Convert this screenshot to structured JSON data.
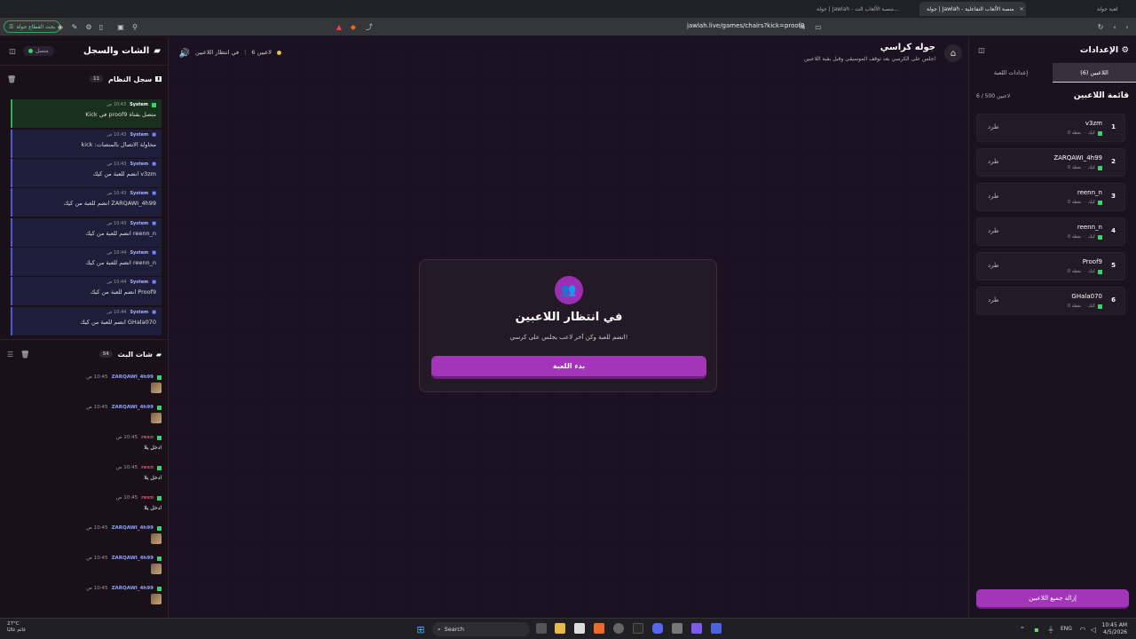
{
  "browser": {
    "tabs": [
      {
        "label": "لعبة جولة"
      },
      {
        "label": "جولة | Jawlah - منصة الألعاب الت..."
      },
      {
        "label": "جولة | Jawlah - منصة الألعاب التفاعلية"
      }
    ],
    "url": "jawlah.live/games/chairs?kick=proof9",
    "split_label": "بحث القطاع جولة"
  },
  "left_panel": {
    "title": "الشات والسجل",
    "connection": "متصل",
    "system_log": {
      "title": "سجل النظام",
      "count": "11",
      "items": [
        {
          "who": "System",
          "time": "10:43 ص",
          "text": "متصل بقناة proof9 في Kick"
        },
        {
          "who": "System",
          "time": "10:43 ص",
          "text": "محاولة الاتصال بالمنصات: kick"
        },
        {
          "who": "System",
          "time": "10:43 ص",
          "text": "v3zm انضم للعبة من كيك"
        },
        {
          "who": "System",
          "time": "10:43 ص",
          "text": "ZARQAWI_4h99 انضم للعبة من كيك"
        },
        {
          "who": "System",
          "time": "10:43 ص",
          "text": "reenn_n انضم للعبة من كيك"
        },
        {
          "who": "System",
          "time": "10:44 ص",
          "text": "reenn_n انضم للعبة من كيك"
        },
        {
          "who": "System",
          "time": "10:44 ص",
          "text": "Proof9 انضم للعبة من كيك"
        },
        {
          "who": "System",
          "time": "10:44 ص",
          "text": "GHala070 انضم للعبة من كيك"
        }
      ]
    },
    "stream_chat": {
      "title": "شات البث",
      "count": "54",
      "messages": [
        {
          "who": "ZARQAWI_4h99",
          "time": "10:45 ص",
          "text": ""
        },
        {
          "who": "ZARQAWI_4h99",
          "time": "10:45 ص",
          "text": ""
        },
        {
          "who": "rexn",
          "time": "10:45 ص",
          "text": "ادخل يلا"
        },
        {
          "who": "rexn",
          "time": "10:45 ص",
          "text": "ادخل يلا"
        },
        {
          "who": "rexn",
          "time": "10:45 ص",
          "text": "ادخل يلا"
        },
        {
          "who": "ZARQAWI_4h99",
          "time": "10:45 ص",
          "text": ""
        },
        {
          "who": "ZARQAWI_4h99",
          "time": "10:45 ص",
          "text": ""
        },
        {
          "who": "ZARQAWI_4h99",
          "time": "10:45 ص",
          "text": ""
        }
      ]
    }
  },
  "center": {
    "game_title": "جوله كراسي",
    "game_subtitle": "اجلس على الكرسي بعد توقف الموسيقى وقبل بقية اللاعبين",
    "player_count": "6 لاعبين",
    "waiting_status": "في انتظار اللاعبين",
    "card_title": "في انتظار اللاعبين",
    "card_subtitle": "انضم للعبة وكن آخر لاعب يجلس على كرسي!",
    "start_button": "بدء اللعبة"
  },
  "right_panel": {
    "title": "الإعدادات",
    "tab_players": "اللاعبين (6)",
    "tab_settings": "إعدادات اللعبة",
    "list_title": "قائمة اللاعبين",
    "list_count": "6 / 500 لاعبين",
    "players": [
      {
        "num": "1",
        "name": "v3zm",
        "platform": "كيك",
        "points": "0 نقطة",
        "kick": "طرد"
      },
      {
        "num": "2",
        "name": "ZARQAWI_4h99",
        "platform": "كيك",
        "points": "0 نقطة",
        "kick": "طرد"
      },
      {
        "num": "3",
        "name": "reenn_n",
        "platform": "كيك",
        "points": "0 نقطة",
        "kick": "طرد"
      },
      {
        "num": "4",
        "name": "reenn_n",
        "platform": "كيك",
        "points": "0 نقطة",
        "kick": "طرد"
      },
      {
        "num": "5",
        "name": "Proof9",
        "platform": "كيك",
        "points": "0 نقطة",
        "kick": "طرد"
      },
      {
        "num": "6",
        "name": "GHala070",
        "platform": "كيك",
        "points": "0 نقطة",
        "kick": "طرد"
      }
    ],
    "remove_all": "إزالة جميع اللاعبين"
  },
  "taskbar": {
    "temp": "27°C",
    "weather": "غائم غالبًا",
    "search": "Search",
    "lang": "ENG",
    "time": "10:45 AM",
    "date": "4/5/2026"
  },
  "colors": {
    "accent": "#a335b8",
    "kick_green": "#3ad46c",
    "bg": "#1b1120"
  }
}
